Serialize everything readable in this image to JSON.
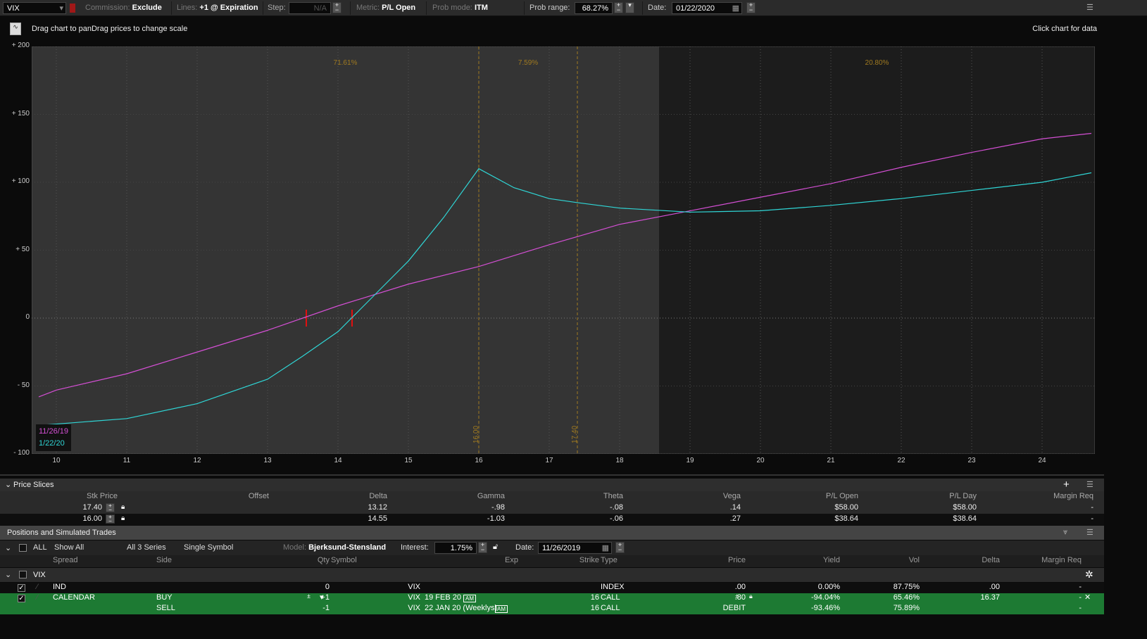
{
  "toolbar": {
    "symbol": "VIX",
    "commission_label": "Commission:",
    "commission": "Exclude",
    "lines_label": "Lines:",
    "lines": "+1 @ Expiration",
    "step_label": "Step:",
    "step": "N/A",
    "metric_label": "Metric:",
    "metric": "P/L Open",
    "prob_mode_label": "Prob mode:",
    "prob_mode": "ITM",
    "prob_range_label": "Prob range:",
    "prob_range": "68.27%",
    "date_label": "Date:",
    "date": "01/22/2020"
  },
  "chart_header": {
    "hint": "Drag chart to panDrag prices to change scale",
    "click_hint": "Click chart for data"
  },
  "chart_data": {
    "type": "line",
    "xlim": [
      9.65,
      24.75
    ],
    "ylim": [
      -100,
      200
    ],
    "x_ticks": [
      "10",
      "11",
      "12",
      "13",
      "14",
      "15",
      "16",
      "17",
      "18",
      "19",
      "20",
      "21",
      "22",
      "23",
      "24"
    ],
    "y_ticks": [
      "+ 200",
      "+ 150",
      "+ 100",
      "+ 50",
      "0",
      "- 50",
      "- 100"
    ],
    "y_tick_values": [
      200,
      150,
      100,
      50,
      0,
      -50,
      -100
    ],
    "prob_regions": [
      {
        "from": 9.65,
        "to": 18.56,
        "label": "71.61%"
      },
      {
        "from": 16,
        "to": 17.4,
        "label": "7.59%"
      },
      {
        "from": 18.56,
        "to": 24.75,
        "label": "20.80%"
      }
    ],
    "slices": [
      {
        "x": 16.0,
        "label": "16.00"
      },
      {
        "x": 17.4,
        "label": "17.40"
      }
    ],
    "breakevens": [
      13.55,
      14.2
    ],
    "series": [
      {
        "name": "11/26/19",
        "color": "#d44fd4",
        "x": [
          9.75,
          10,
          11,
          12,
          13,
          14,
          15,
          16,
          17,
          18,
          19,
          20,
          21,
          22,
          23,
          24,
          24.7
        ],
        "y": [
          -58,
          -53,
          -41,
          -25,
          -9,
          9,
          25,
          38,
          54,
          69,
          79,
          89,
          99,
          111,
          122,
          132,
          136
        ]
      },
      {
        "name": "1/22/20",
        "color": "#2fd6d6",
        "x": [
          9.75,
          10,
          11,
          12,
          13,
          13.5,
          14,
          14.5,
          15,
          15.5,
          16,
          16.5,
          17,
          17.4,
          18,
          19,
          20,
          21,
          22,
          23,
          24,
          24.7
        ],
        "y": [
          -79,
          -78,
          -74,
          -63,
          -45,
          -28,
          -10,
          16,
          42,
          74,
          110,
          96,
          88,
          85,
          81,
          78,
          79,
          83,
          88,
          94,
          100,
          107
        ]
      }
    ]
  },
  "price_slices": {
    "title": "Price Slices",
    "columns": [
      "Stk Price",
      "Offset",
      "Delta",
      "Gamma",
      "Theta",
      "Vega",
      "P/L Open",
      "P/L Day",
      "Margin Req"
    ],
    "rows": [
      [
        "17.40",
        "",
        "13.12",
        "-.98",
        "-.08",
        ".14",
        "$58.00",
        "$58.00",
        "-"
      ],
      [
        "16.00",
        "",
        "14.55",
        "-1.03",
        "-.06",
        ".27",
        "$38.64",
        "$38.64",
        "-"
      ]
    ]
  },
  "positions": {
    "title": "Positions and Simulated Trades",
    "all": "ALL",
    "filter1": "Show All",
    "filter2": "All 3 Series",
    "filter3": "Single Symbol",
    "model_label": "Model:",
    "model": "Bjerksund-Stensland",
    "interest_label": "Interest:",
    "interest": "1.75%",
    "date_label": "Date:",
    "date": "11/26/2019",
    "columns": [
      "Spread",
      "Side",
      "Qty",
      "Symbol",
      "Exp",
      "Strike",
      "Type",
      "Price",
      "Yield",
      "Vol",
      "Delta",
      "Margin Req"
    ],
    "group": "VIX",
    "rows": [
      {
        "spread": "IND",
        "side": "",
        "qty": "0",
        "symbol": "VIX",
        "exp": "",
        "strike": "",
        "type": "INDEX",
        "price": ".00",
        "yield": "0.00%",
        "vol": "87.75%",
        "delta": ".00",
        "margin": "-"
      },
      {
        "spread": "CALENDAR",
        "side": "BUY",
        "qty": "+1",
        "symbol": "VIX",
        "exp": "19 FEB 20",
        "exp_tag": "AM",
        "strike": "16",
        "type": "CALL",
        "price": ".80",
        "yield": "-94.04%",
        "vol": "65.46%",
        "delta": "16.37",
        "margin": "-"
      },
      {
        "spread": "",
        "side": "SELL",
        "qty": "-1",
        "symbol": "VIX",
        "exp": "22 JAN 20 (Weeklys)",
        "exp_tag": "AM",
        "strike": "16",
        "type": "CALL",
        "price": "DEBIT",
        "yield": "-93.46%",
        "vol": "75.89%",
        "delta": "",
        "margin": "-"
      }
    ]
  }
}
